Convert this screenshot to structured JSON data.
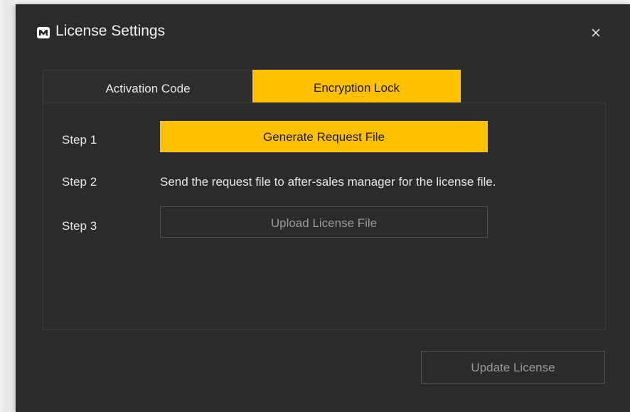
{
  "dialog": {
    "title": "License Settings",
    "app_icon": "brand-m-logo-icon",
    "close_icon": "close-icon"
  },
  "tabs": [
    {
      "label": "Activation Code",
      "selected": false
    },
    {
      "label": "Encryption Lock",
      "selected": true
    }
  ],
  "steps": [
    {
      "label": "Step 1",
      "action_label": "Generate Request File"
    },
    {
      "label": "Step 2",
      "text": "Send the request file to after-sales manager for the license file."
    },
    {
      "label": "Step 3",
      "action_label": "Upload License File"
    }
  ],
  "footer": {
    "update_label": "Update License"
  },
  "colors": {
    "accent": "#ffc000",
    "dialog_bg": "#2b2b2b",
    "text": "#e6e6e6",
    "disabled_text": "#9a9a9a"
  }
}
